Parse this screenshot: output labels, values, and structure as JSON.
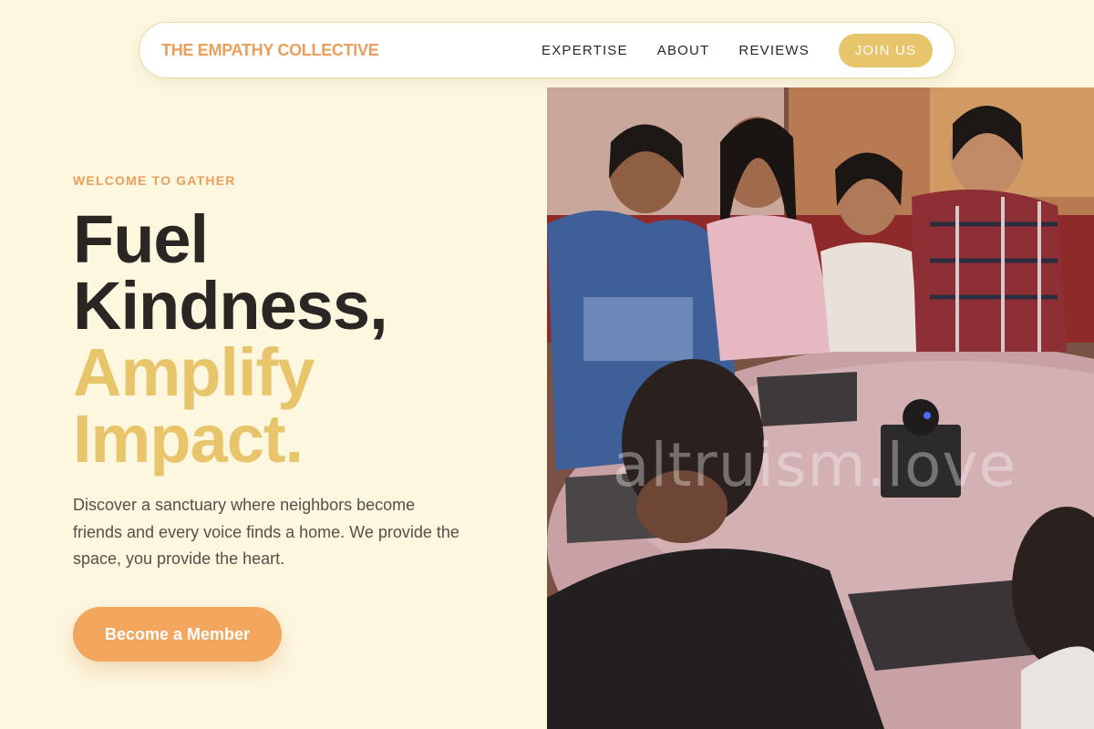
{
  "nav": {
    "brand": "THE EMPATHY COLLECTIVE",
    "links": [
      "EXPERTISE",
      "ABOUT",
      "REVIEWS"
    ],
    "cta": "JOIN US"
  },
  "hero": {
    "eyebrow": "WELCOME TO GATHER",
    "headline_line1": "Fuel",
    "headline_line2": "Kindness,",
    "headline_line3": "Amplify",
    "headline_line4": "Impact.",
    "lead": "Discover a sanctuary where neighbors become friends and every voice finds a home. We provide the space, you provide the heart.",
    "cta": "Become a Member"
  },
  "photo": {
    "watermark": "altruism.love",
    "description_icon": "group-photo-image"
  },
  "colors": {
    "background": "#fdf7e0",
    "accent_orange": "#eaa05c",
    "accent_gold": "#e8c56a",
    "cta_orange": "#f2a65e",
    "text_dark": "#2a2624"
  }
}
